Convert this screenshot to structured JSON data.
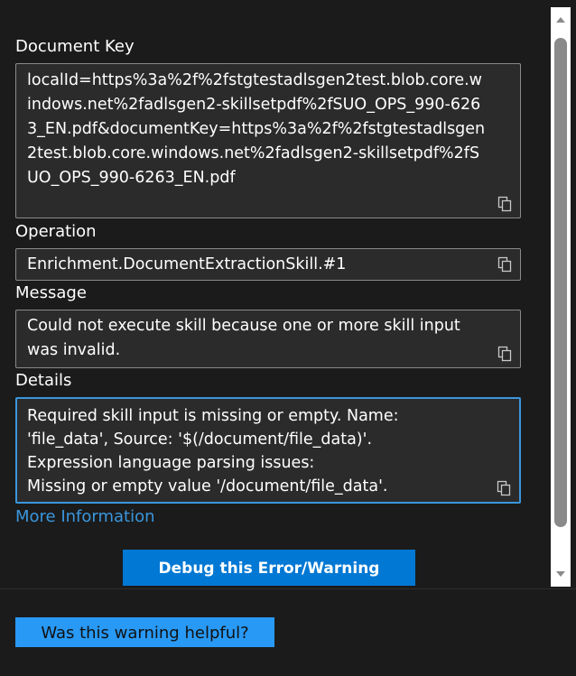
{
  "fields": {
    "document_key": {
      "label": "Document Key",
      "value": "localId=https%3a%2f%2fstgtestadlsgen2test.blob.core.windows.net%2fadlsgen2-skillsetpdf%2fSUO_OPS_990-6263_EN.pdf&documentKey=https%3a%2f%2fstgtestadlsgen2test.blob.core.windows.net%2fadlsgen2-skillsetpdf%2fSUO_OPS_990-6263_EN.pdf"
    },
    "operation": {
      "label": "Operation",
      "value": "Enrichment.DocumentExtractionSkill.#1"
    },
    "message": {
      "label": "Message",
      "value": "Could not execute skill because one or more skill input was invalid."
    },
    "details": {
      "label": "Details",
      "value": "Required skill input is missing or empty. Name: 'file_data', Source: '$(/document/file_data)'.\nExpression language parsing issues:\nMissing or empty value '/document/file_data'."
    }
  },
  "more_info_link": "More Information",
  "debug_button": "Debug this Error/Warning",
  "helpful_button": "Was this warning helpful?",
  "icons": {
    "copy": "copy-icon",
    "scroll_up": "chevron-up-icon",
    "scroll_down": "chevron-down-icon"
  },
  "colors": {
    "background": "#1b1b1b",
    "field_bg": "#2b2b2b",
    "accent": "#0078d4",
    "link": "#3a96dd",
    "focus_border": "#3a96dd"
  }
}
